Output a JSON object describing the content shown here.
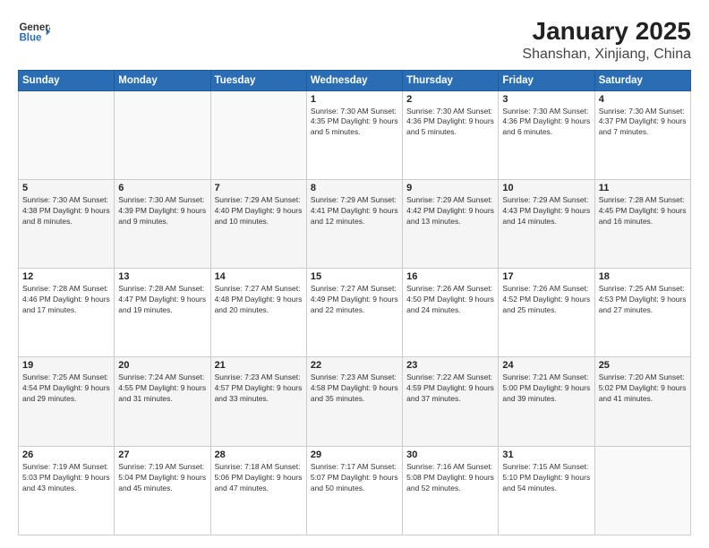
{
  "header": {
    "logo_general": "General",
    "logo_blue": "Blue",
    "title": "January 2025",
    "subtitle": "Shanshan, Xinjiang, China"
  },
  "weekdays": [
    "Sunday",
    "Monday",
    "Tuesday",
    "Wednesday",
    "Thursday",
    "Friday",
    "Saturday"
  ],
  "weeks": [
    [
      {
        "day": "",
        "info": ""
      },
      {
        "day": "",
        "info": ""
      },
      {
        "day": "",
        "info": ""
      },
      {
        "day": "1",
        "info": "Sunrise: 7:30 AM\nSunset: 4:35 PM\nDaylight: 9 hours and 5 minutes."
      },
      {
        "day": "2",
        "info": "Sunrise: 7:30 AM\nSunset: 4:36 PM\nDaylight: 9 hours and 5 minutes."
      },
      {
        "day": "3",
        "info": "Sunrise: 7:30 AM\nSunset: 4:36 PM\nDaylight: 9 hours and 6 minutes."
      },
      {
        "day": "4",
        "info": "Sunrise: 7:30 AM\nSunset: 4:37 PM\nDaylight: 9 hours and 7 minutes."
      }
    ],
    [
      {
        "day": "5",
        "info": "Sunrise: 7:30 AM\nSunset: 4:38 PM\nDaylight: 9 hours and 8 minutes."
      },
      {
        "day": "6",
        "info": "Sunrise: 7:30 AM\nSunset: 4:39 PM\nDaylight: 9 hours and 9 minutes."
      },
      {
        "day": "7",
        "info": "Sunrise: 7:29 AM\nSunset: 4:40 PM\nDaylight: 9 hours and 10 minutes."
      },
      {
        "day": "8",
        "info": "Sunrise: 7:29 AM\nSunset: 4:41 PM\nDaylight: 9 hours and 12 minutes."
      },
      {
        "day": "9",
        "info": "Sunrise: 7:29 AM\nSunset: 4:42 PM\nDaylight: 9 hours and 13 minutes."
      },
      {
        "day": "10",
        "info": "Sunrise: 7:29 AM\nSunset: 4:43 PM\nDaylight: 9 hours and 14 minutes."
      },
      {
        "day": "11",
        "info": "Sunrise: 7:28 AM\nSunset: 4:45 PM\nDaylight: 9 hours and 16 minutes."
      }
    ],
    [
      {
        "day": "12",
        "info": "Sunrise: 7:28 AM\nSunset: 4:46 PM\nDaylight: 9 hours and 17 minutes."
      },
      {
        "day": "13",
        "info": "Sunrise: 7:28 AM\nSunset: 4:47 PM\nDaylight: 9 hours and 19 minutes."
      },
      {
        "day": "14",
        "info": "Sunrise: 7:27 AM\nSunset: 4:48 PM\nDaylight: 9 hours and 20 minutes."
      },
      {
        "day": "15",
        "info": "Sunrise: 7:27 AM\nSunset: 4:49 PM\nDaylight: 9 hours and 22 minutes."
      },
      {
        "day": "16",
        "info": "Sunrise: 7:26 AM\nSunset: 4:50 PM\nDaylight: 9 hours and 24 minutes."
      },
      {
        "day": "17",
        "info": "Sunrise: 7:26 AM\nSunset: 4:52 PM\nDaylight: 9 hours and 25 minutes."
      },
      {
        "day": "18",
        "info": "Sunrise: 7:25 AM\nSunset: 4:53 PM\nDaylight: 9 hours and 27 minutes."
      }
    ],
    [
      {
        "day": "19",
        "info": "Sunrise: 7:25 AM\nSunset: 4:54 PM\nDaylight: 9 hours and 29 minutes."
      },
      {
        "day": "20",
        "info": "Sunrise: 7:24 AM\nSunset: 4:55 PM\nDaylight: 9 hours and 31 minutes."
      },
      {
        "day": "21",
        "info": "Sunrise: 7:23 AM\nSunset: 4:57 PM\nDaylight: 9 hours and 33 minutes."
      },
      {
        "day": "22",
        "info": "Sunrise: 7:23 AM\nSunset: 4:58 PM\nDaylight: 9 hours and 35 minutes."
      },
      {
        "day": "23",
        "info": "Sunrise: 7:22 AM\nSunset: 4:59 PM\nDaylight: 9 hours and 37 minutes."
      },
      {
        "day": "24",
        "info": "Sunrise: 7:21 AM\nSunset: 5:00 PM\nDaylight: 9 hours and 39 minutes."
      },
      {
        "day": "25",
        "info": "Sunrise: 7:20 AM\nSunset: 5:02 PM\nDaylight: 9 hours and 41 minutes."
      }
    ],
    [
      {
        "day": "26",
        "info": "Sunrise: 7:19 AM\nSunset: 5:03 PM\nDaylight: 9 hours and 43 minutes."
      },
      {
        "day": "27",
        "info": "Sunrise: 7:19 AM\nSunset: 5:04 PM\nDaylight: 9 hours and 45 minutes."
      },
      {
        "day": "28",
        "info": "Sunrise: 7:18 AM\nSunset: 5:06 PM\nDaylight: 9 hours and 47 minutes."
      },
      {
        "day": "29",
        "info": "Sunrise: 7:17 AM\nSunset: 5:07 PM\nDaylight: 9 hours and 50 minutes."
      },
      {
        "day": "30",
        "info": "Sunrise: 7:16 AM\nSunset: 5:08 PM\nDaylight: 9 hours and 52 minutes."
      },
      {
        "day": "31",
        "info": "Sunrise: 7:15 AM\nSunset: 5:10 PM\nDaylight: 9 hours and 54 minutes."
      },
      {
        "day": "",
        "info": ""
      }
    ]
  ]
}
